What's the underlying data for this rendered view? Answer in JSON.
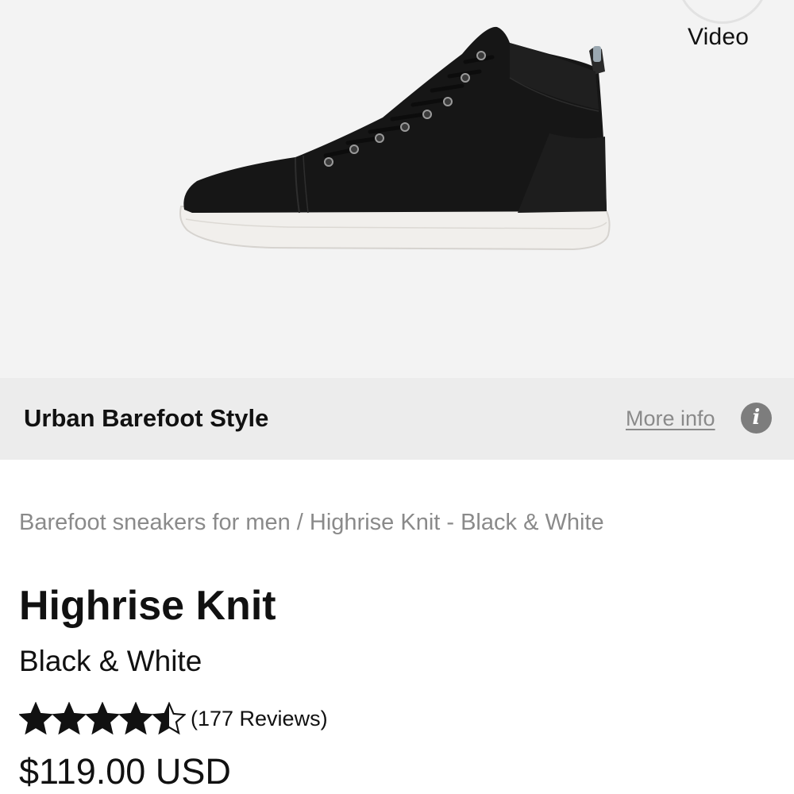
{
  "hero": {
    "video_label": "Video",
    "image_alt": "Highrise Knit sneaker side view"
  },
  "brand_bar": {
    "title": "Urban Barefoot Style",
    "more_info": "More info",
    "info_icon": "info-icon"
  },
  "breadcrumb": {
    "category": "Barefoot sneakers for men",
    "separator": "/",
    "current": "Highrise Knit - Black & White"
  },
  "product": {
    "name": "Highrise Knit",
    "variant": "Black & White",
    "rating": 4.5,
    "rating_max": 5,
    "reviews_label": "(177 Reviews)",
    "price": "$119.00 USD"
  },
  "colors": {
    "hero_bg": "#f3f3f3",
    "brand_bar_bg": "#ececec",
    "muted_text": "#8a8a8a",
    "primary_text": "#111111"
  }
}
